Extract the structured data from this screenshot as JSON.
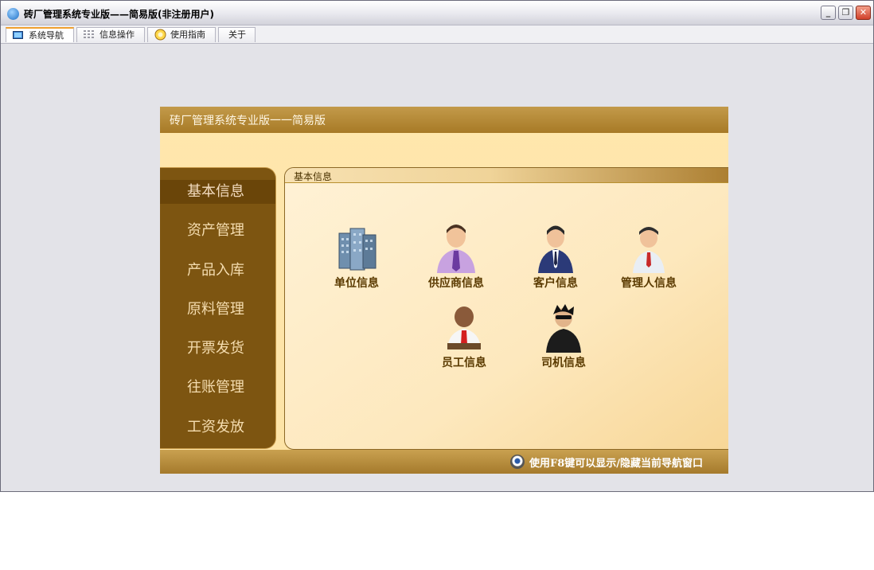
{
  "window": {
    "title": "砖厂管理系统专业版——简易版(非注册用户)",
    "controls": {
      "minimize": "_",
      "maximize": "❐",
      "close": "✕"
    }
  },
  "tabs": [
    {
      "label": "系统导航",
      "icon": "monitor-icon",
      "active": true
    },
    {
      "label": "信息操作",
      "icon": "grid-icon",
      "active": false
    },
    {
      "label": "使用指南",
      "icon": "help-icon",
      "active": false
    },
    {
      "label": "关于",
      "icon": "",
      "active": false
    }
  ],
  "panel": {
    "title": "砖厂管理系统专业版一一简易版",
    "section_title": "基本信息",
    "footer_hint": "使用F8键可以显示/隐藏当前导航窗口"
  },
  "sidebar": {
    "items": [
      {
        "label": "基本信息",
        "active": true
      },
      {
        "label": "资产管理",
        "active": false
      },
      {
        "label": "产品入库",
        "active": false
      },
      {
        "label": "原料管理",
        "active": false
      },
      {
        "label": "开票发货",
        "active": false
      },
      {
        "label": "往账管理",
        "active": false
      },
      {
        "label": "工资发放",
        "active": false
      }
    ]
  },
  "items": [
    {
      "label": "单位信息",
      "icon": "building-icon"
    },
    {
      "label": "供应商信息",
      "icon": "supplier-person-icon"
    },
    {
      "label": "客户信息",
      "icon": "customer-person-icon"
    },
    {
      "label": "管理人信息",
      "icon": "manager-person-icon"
    },
    {
      "label": "员工信息",
      "icon": "employee-person-icon"
    },
    {
      "label": "司机信息",
      "icon": "driver-person-icon"
    }
  ],
  "colors": {
    "sidebar_bg": "#7d5511",
    "panel_header": "#a77a26",
    "content_bg": "#fde8bd"
  }
}
